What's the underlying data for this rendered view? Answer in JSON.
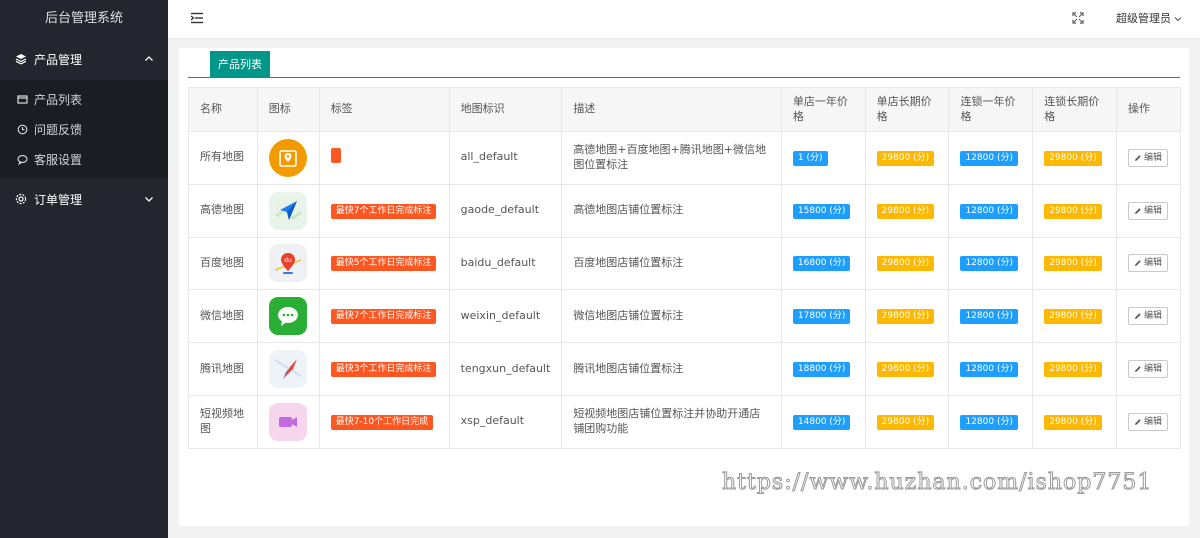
{
  "app": {
    "title": "后台管理系统"
  },
  "sidebar": {
    "groups": [
      {
        "label": "产品管理",
        "icon": "layers-icon",
        "expanded": true,
        "items": [
          {
            "label": "产品列表",
            "icon": "list-window-icon"
          },
          {
            "label": "问题反馈",
            "icon": "clock-icon"
          },
          {
            "label": "客服设置",
            "icon": "chat-icon"
          }
        ]
      },
      {
        "label": "订单管理",
        "icon": "gear-icon",
        "expanded": false,
        "items": []
      }
    ]
  },
  "header": {
    "user_label": "超级管理员"
  },
  "page": {
    "tab_label": "产品列表"
  },
  "table": {
    "columns": [
      "名称",
      "图标",
      "标签",
      "地图标识",
      "描述",
      "单店一年价格",
      "单店长期价格",
      "连锁一年价格",
      "连锁长期价格",
      "操作"
    ],
    "edit_label": "编辑",
    "rows": [
      {
        "name": "所有地图",
        "icon": "all-maps-icon",
        "tag": "",
        "code": "all_default",
        "desc": "高德地图+百度地图+腾讯地图+微信地图位置标注",
        "p1": "1 (分)",
        "p2": "29800 (分)",
        "p3": "12800 (分)",
        "p4": "29800 (分)"
      },
      {
        "name": "高德地图",
        "icon": "gaode-map-icon",
        "tag": "最快7个工作日完成标注",
        "code": "gaode_default",
        "desc": "高德地图店铺位置标注",
        "p1": "15800 (分)",
        "p2": "29800 (分)",
        "p3": "12800 (分)",
        "p4": "29800 (分)"
      },
      {
        "name": "百度地图",
        "icon": "baidu-map-icon",
        "tag": "最快5个工作日完成标注",
        "code": "baidu_default",
        "desc": "百度地图店铺位置标注",
        "p1": "16800 (分)",
        "p2": "29800 (分)",
        "p3": "12800 (分)",
        "p4": "29800 (分)"
      },
      {
        "name": "微信地图",
        "icon": "wechat-icon",
        "tag": "最快7个工作日完成标注",
        "code": "weixin_default",
        "desc": "微信地图店铺位置标注",
        "p1": "17800 (分)",
        "p2": "29800 (分)",
        "p3": "12800 (分)",
        "p4": "29800 (分)"
      },
      {
        "name": "腾讯地图",
        "icon": "tencent-map-icon",
        "tag": "最快3个工作日完成标注",
        "code": "tengxun_default",
        "desc": "腾讯地图店铺位置标注",
        "p1": "18800 (分)",
        "p2": "29800 (分)",
        "p3": "12800 (分)",
        "p4": "29800 (分)"
      },
      {
        "name": "短视频地图",
        "icon": "short-video-icon",
        "tag": "最快7-10个工作日完成",
        "code": "xsp_default",
        "desc": "短视频地图店铺位置标注并协助开通店铺团购功能",
        "p1": "14800 (分)",
        "p2": "29800 (分)",
        "p3": "12800 (分)",
        "p4": "29800 (分)"
      }
    ]
  },
  "watermark": "https://www.huzhan.com/ishop7751",
  "colors": {
    "sidebar_bg": "#23262e",
    "accent_teal": "#009688",
    "tag_red": "#ff5722",
    "price_blue": "#1e9fff",
    "price_orange": "#ffb800"
  }
}
